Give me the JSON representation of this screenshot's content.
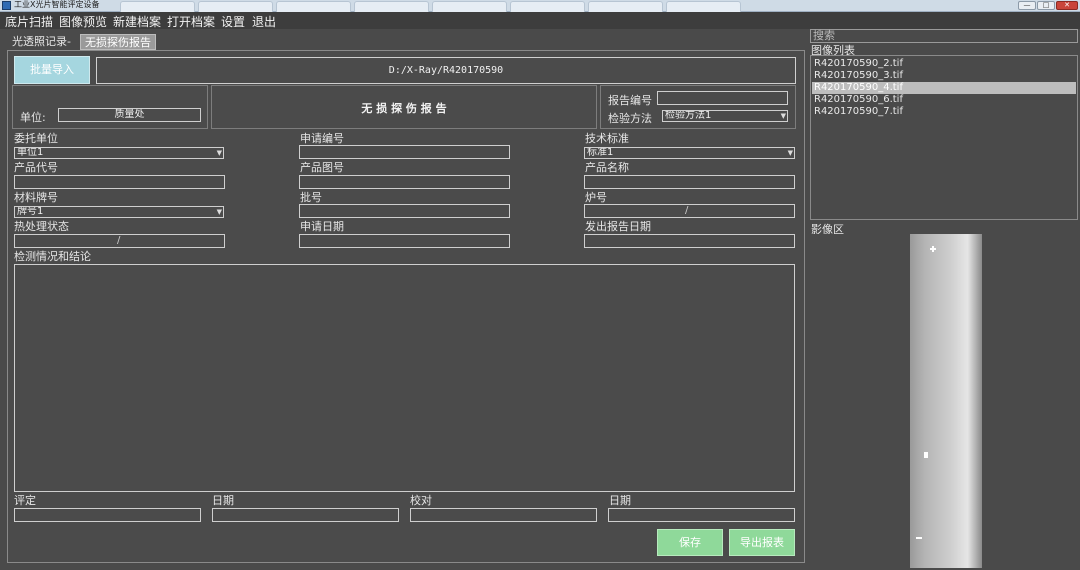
{
  "window": {
    "title": "工业X光片智能评定设备",
    "controls": [
      "—",
      "□",
      "✕"
    ]
  },
  "menu": [
    "底片扫描",
    "图像预览",
    "新建档案",
    "打开档案",
    "设置",
    "退出"
  ],
  "tabs": [
    "光透照记录-",
    "无损探伤报告"
  ],
  "toolbar": {
    "import_label": "批量导入",
    "path": "D:/X-Ray/R420170590"
  },
  "header": {
    "unit_label": "单位:",
    "unit_value": "质量处",
    "report_title": "无 损 探 伤 报 告",
    "report_no_label": "报告编号",
    "method_label": "检验方法",
    "method_value": "检验方法1"
  },
  "form": {
    "client_unit_label": "委托单位",
    "client_unit_value": "单位1",
    "application_no_label": "申请编号",
    "tech_standard_label": "技术标准",
    "tech_standard_value": "标准1",
    "product_code_label": "产品代号",
    "product_drawing_label": "产品图号",
    "product_name_label": "产品名称",
    "material_grade_label": "材料牌号",
    "material_grade_value": "牌号1",
    "batch_label": "批号",
    "furnace_label": "炉号",
    "heat_treatment_label": "热处理状态",
    "application_date_label": "申请日期",
    "issue_date_label": "发出报告日期",
    "conclusion_label": "检测情况和结论",
    "slash": "/"
  },
  "footer": {
    "evaluate_label": "评定",
    "date1_label": "日期",
    "proofread_label": "校对",
    "date2_label": "日期",
    "save_label": "保存",
    "export_label": "导出报表"
  },
  "right_panel": {
    "search_placeholder": "搜索",
    "image_list_label": "图像列表",
    "images": [
      "R420170590_2.tif",
      "R420170590_3.tif",
      "R420170590_4.tif",
      "R420170590_6.tif",
      "R420170590_7.tif"
    ],
    "selected_index": 2,
    "image_area_label": "影像区"
  },
  "colors": {
    "background": "#4a4a4a",
    "accent_cyan": "#a5d6df",
    "accent_green": "#8fd99a"
  }
}
